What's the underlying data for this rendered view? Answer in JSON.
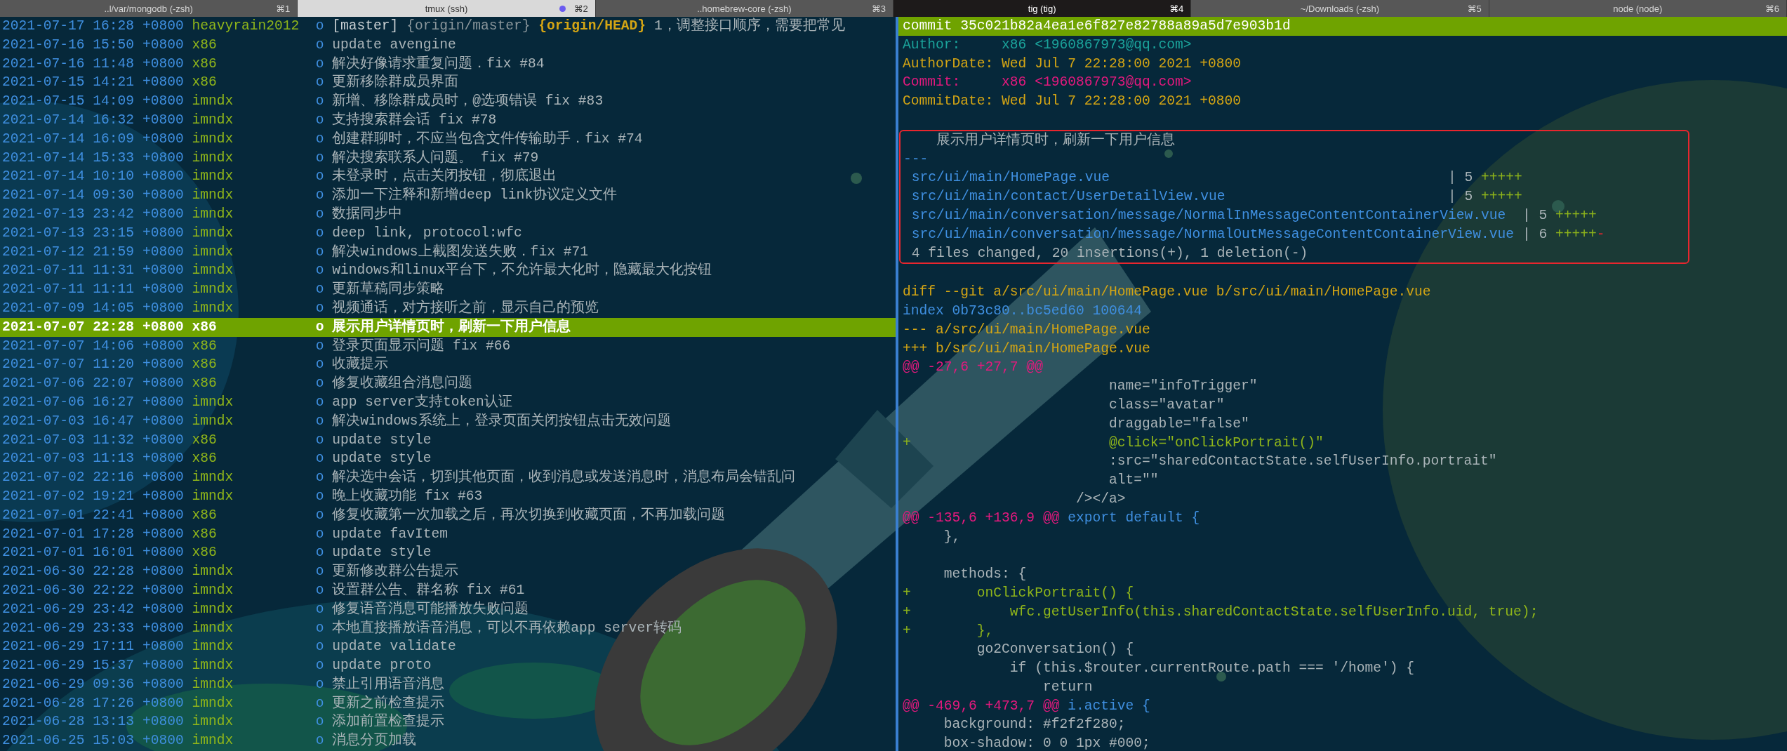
{
  "tabs": [
    {
      "label": "..l/var/mongodb (-zsh)",
      "shortcut": "⌘1",
      "selected": false,
      "activity": false
    },
    {
      "label": "tmux (ssh)",
      "shortcut": "⌘2",
      "selected": false,
      "activity": true
    },
    {
      "label": "..homebrew-core (-zsh)",
      "shortcut": "⌘3",
      "selected": false,
      "activity": false
    },
    {
      "label": "tig (tig)",
      "shortcut": "⌘4",
      "selected": true,
      "activity": false
    },
    {
      "label": "~/Downloads (-zsh)",
      "shortcut": "⌘5",
      "selected": false,
      "activity": false
    },
    {
      "label": "node (node)",
      "shortcut": "⌘6",
      "selected": false,
      "activity": false
    }
  ],
  "log_view": {
    "rows": [
      {
        "date": "2021-07-17 16:28 +0800",
        "author": "heavyrain2012",
        "graph": "o",
        "refs": [
          {
            "text": "[master]",
            "kind": "branch"
          },
          {
            "text": "{origin/master}",
            "kind": "remote"
          },
          {
            "text": "{origin/HEAD}",
            "kind": "head"
          }
        ],
        "message": "1，调整接口顺序，需要把常见",
        "selected": false
      },
      {
        "date": "2021-07-16 15:50 +0800",
        "author": "x86",
        "graph": "o",
        "message": "update avengine",
        "selected": false
      },
      {
        "date": "2021-07-16 11:48 +0800",
        "author": "x86",
        "graph": "o",
        "message": "解决好像请求重复问题．fix #84",
        "selected": false
      },
      {
        "date": "2021-07-15 14:21 +0800",
        "author": "x86",
        "graph": "o",
        "message": "更新移除群成员界面",
        "selected": false
      },
      {
        "date": "2021-07-15 14:09 +0800",
        "author": "imndx",
        "graph": "o",
        "message": "新增、移除群成员时，@选项错误 fix #83",
        "selected": false
      },
      {
        "date": "2021-07-14 16:32 +0800",
        "author": "imndx",
        "graph": "o",
        "message": "支持搜索群会话 fix #78",
        "selected": false
      },
      {
        "date": "2021-07-14 16:09 +0800",
        "author": "imndx",
        "graph": "o",
        "message": "创建群聊时，不应当包含文件传输助手．fix #74",
        "selected": false
      },
      {
        "date": "2021-07-14 15:33 +0800",
        "author": "imndx",
        "graph": "o",
        "message": "解决搜索联系人问题。 fix #79",
        "selected": false
      },
      {
        "date": "2021-07-14 10:10 +0800",
        "author": "imndx",
        "graph": "o",
        "message": "未登录时，点击关闭按钮，彻底退出",
        "selected": false
      },
      {
        "date": "2021-07-14 09:30 +0800",
        "author": "imndx",
        "graph": "o",
        "message": "添加一下注释和新增deep link协议定义文件",
        "selected": false
      },
      {
        "date": "2021-07-13 23:42 +0800",
        "author": "imndx",
        "graph": "o",
        "message": "数据同步中",
        "selected": false
      },
      {
        "date": "2021-07-13 23:15 +0800",
        "author": "imndx",
        "graph": "o",
        "message": "deep link, protocol:wfc",
        "selected": false
      },
      {
        "date": "2021-07-12 21:59 +0800",
        "author": "imndx",
        "graph": "o",
        "message": "解决windows上截图发送失败．fix #71",
        "selected": false
      },
      {
        "date": "2021-07-11 11:31 +0800",
        "author": "imndx",
        "graph": "o",
        "message": "windows和linux平台下，不允许最大化时，隐藏最大化按钮",
        "selected": false
      },
      {
        "date": "2021-07-11 11:11 +0800",
        "author": "imndx",
        "graph": "o",
        "message": "更新草稿同步策略",
        "selected": false
      },
      {
        "date": "2021-07-09 14:05 +0800",
        "author": "imndx",
        "graph": "o",
        "message": "视频通话，对方接听之前，显示自己的预览",
        "selected": false
      },
      {
        "date": "2021-07-07 22:28 +0800",
        "author": "x86",
        "graph": "o",
        "message": "展示用户详情页时，刷新一下用户信息",
        "selected": true
      },
      {
        "date": "2021-07-07 14:06 +0800",
        "author": "x86",
        "graph": "o",
        "message": "登录页面显示问题 fix #66",
        "selected": false
      },
      {
        "date": "2021-07-07 11:20 +0800",
        "author": "x86",
        "graph": "o",
        "message": "收藏提示",
        "selected": false
      },
      {
        "date": "2021-07-06 22:07 +0800",
        "author": "x86",
        "graph": "o",
        "message": "修复收藏组合消息问题",
        "selected": false
      },
      {
        "date": "2021-07-06 16:27 +0800",
        "author": "imndx",
        "graph": "o",
        "message": "app server支持token认证",
        "selected": false
      },
      {
        "date": "2021-07-03 16:47 +0800",
        "author": "imndx",
        "graph": "o",
        "message": "解决windows系统上，登录页面关闭按钮点击无效问题",
        "selected": false
      },
      {
        "date": "2021-07-03 11:32 +0800",
        "author": "x86",
        "graph": "o",
        "message": "update style",
        "selected": false
      },
      {
        "date": "2021-07-03 11:13 +0800",
        "author": "x86",
        "graph": "o",
        "message": "update style",
        "selected": false
      },
      {
        "date": "2021-07-02 22:16 +0800",
        "author": "imndx",
        "graph": "o",
        "message": "解决选中会话，切到其他页面，收到消息或发送消息时，消息布局会错乱问",
        "selected": false
      },
      {
        "date": "2021-07-02 19:21 +0800",
        "author": "imndx",
        "graph": "o",
        "message": "晚上收藏功能 fix #63",
        "selected": false
      },
      {
        "date": "2021-07-01 22:41 +0800",
        "author": "x86",
        "graph": "o",
        "message": "修复收藏第一次加载之后，再次切换到收藏页面，不再加载问题",
        "selected": false
      },
      {
        "date": "2021-07-01 17:28 +0800",
        "author": "x86",
        "graph": "o",
        "message": "update favItem",
        "selected": false
      },
      {
        "date": "2021-07-01 16:01 +0800",
        "author": "x86",
        "graph": "o",
        "message": "update style",
        "selected": false
      },
      {
        "date": "2021-06-30 22:28 +0800",
        "author": "imndx",
        "graph": "o",
        "message": "更新修改群公告提示",
        "selected": false
      },
      {
        "date": "2021-06-30 22:22 +0800",
        "author": "imndx",
        "graph": "o",
        "message": "设置群公告、群名称 fix #61",
        "selected": false
      },
      {
        "date": "2021-06-29 23:42 +0800",
        "author": "imndx",
        "graph": "o",
        "message": "修复语音消息可能播放失败问题",
        "selected": false
      },
      {
        "date": "2021-06-29 23:33 +0800",
        "author": "imndx",
        "graph": "o",
        "message": "本地直接播放语音消息，可以不再依赖app server转码",
        "selected": false
      },
      {
        "date": "2021-06-29 17:11 +0800",
        "author": "imndx",
        "graph": "o",
        "message": "update validate",
        "selected": false
      },
      {
        "date": "2021-06-29 15:37 +0800",
        "author": "imndx",
        "graph": "o",
        "message": "update proto",
        "selected": false
      },
      {
        "date": "2021-06-29 09:36 +0800",
        "author": "imndx",
        "graph": "o",
        "message": "禁止引用语音消息",
        "selected": false
      },
      {
        "date": "2021-06-28 17:26 +0800",
        "author": "imndx",
        "graph": "o",
        "message": "更新之前检查提示",
        "selected": false
      },
      {
        "date": "2021-06-28 13:13 +0800",
        "author": "imndx",
        "graph": "o",
        "message": "添加前置检查提示",
        "selected": false
      },
      {
        "date": "2021-06-25 15:03 +0800",
        "author": "imndx",
        "graph": "o",
        "message": "消息分页加载",
        "selected": false
      }
    ]
  },
  "diff_view": {
    "header_lines": [
      {
        "selected": true,
        "segments": [
          {
            "text": "commit 35c021b82a4ea1e6f827e82788a89a5d7e903b1d",
            "kind": "plain"
          }
        ]
      },
      {
        "selected": false,
        "segments": [
          {
            "text": "Author:     x86 <1960867973@qq.com>",
            "kind": "teal"
          }
        ]
      },
      {
        "selected": false,
        "segments": [
          {
            "text": "AuthorDate: Wed Jul 7 22:28:00 2021 +0800",
            "kind": "yellow"
          }
        ]
      },
      {
        "selected": false,
        "segments": [
          {
            "text": "Commit:     x86 <1960867973@qq.com>",
            "kind": "magenta"
          }
        ]
      },
      {
        "selected": false,
        "segments": [
          {
            "text": "CommitDate: Wed Jul 7 22:28:00 2021 +0800",
            "kind": "yellow"
          }
        ]
      }
    ],
    "highlighted_block": [
      {
        "segments": [
          {
            "text": "    展示用户详情页时，刷新一下用户信息",
            "kind": "plain"
          }
        ]
      },
      {
        "segments": [
          {
            "text": "---",
            "kind": "blue"
          }
        ]
      },
      {
        "segments": [
          {
            "text": " src/ui/main/HomePage.vue                                         ",
            "kind": "blue"
          },
          {
            "text": "| 5",
            "kind": "plain"
          },
          {
            "text": " +++++",
            "kind": "green"
          }
        ]
      },
      {
        "segments": [
          {
            "text": " src/ui/main/contact/UserDetailView.vue                           ",
            "kind": "blue"
          },
          {
            "text": "| 5",
            "kind": "plain"
          },
          {
            "text": " +++++",
            "kind": "green"
          }
        ]
      },
      {
        "segments": [
          {
            "text": " src/ui/main/conversation/message/NormalInMessageContentContainerView.vue  ",
            "kind": "blue"
          },
          {
            "text": "| 5",
            "kind": "plain"
          },
          {
            "text": " +++++",
            "kind": "green"
          }
        ]
      },
      {
        "segments": [
          {
            "text": " src/ui/main/conversation/message/NormalOutMessageContentContainerView.vue ",
            "kind": "blue"
          },
          {
            "text": "| 6",
            "kind": "plain"
          },
          {
            "text": " +++++",
            "kind": "green"
          },
          {
            "text": "-",
            "kind": "red"
          }
        ]
      },
      {
        "segments": [
          {
            "text": " 4 files changed, 20 insertions(+), 1 deletion(-)",
            "kind": "plain"
          }
        ]
      }
    ],
    "diff_lines": [
      {
        "segments": [
          {
            "text": "diff --git a/src/ui/main/HomePage.vue b/src/ui/main/HomePage.vue",
            "kind": "yellow"
          }
        ]
      },
      {
        "segments": [
          {
            "text": "index 0b73c80..bc5ed60 100644",
            "kind": "blue"
          }
        ]
      },
      {
        "segments": [
          {
            "text": "--- a/src/ui/main/HomePage.vue",
            "kind": "yellow"
          }
        ]
      },
      {
        "segments": [
          {
            "text": "+++ b/src/ui/main/HomePage.vue",
            "kind": "yellow"
          }
        ]
      },
      {
        "segments": [
          {
            "text": "@@ -27,6 +27,7 @@",
            "kind": "magenta"
          }
        ]
      },
      {
        "segments": [
          {
            "text": "                         name=\"infoTrigger\"",
            "kind": "plain"
          }
        ]
      },
      {
        "segments": [
          {
            "text": "                         class=\"avatar\"",
            "kind": "plain"
          }
        ]
      },
      {
        "segments": [
          {
            "text": "                         draggable=\"false\"",
            "kind": "plain"
          }
        ]
      },
      {
        "segments": [
          {
            "text": "+",
            "kind": "green"
          },
          {
            "text": "                        @click=\"onClickPortrait()\"",
            "kind": "green"
          }
        ]
      },
      {
        "segments": [
          {
            "text": "                         :src=\"sharedContactState.selfUserInfo.portrait\"",
            "kind": "plain"
          }
        ]
      },
      {
        "segments": [
          {
            "text": "                         alt=\"\"",
            "kind": "plain"
          }
        ]
      },
      {
        "segments": [
          {
            "text": "                     /></a>",
            "kind": "plain"
          }
        ]
      },
      {
        "segments": [
          {
            "text": "@@ -135,6 +136,9 @@",
            "kind": "magenta"
          },
          {
            "text": " export default {",
            "kind": "blue"
          }
        ]
      },
      {
        "segments": [
          {
            "text": "     },",
            "kind": "plain"
          }
        ]
      },
      {
        "gap_before": true,
        "segments": [
          {
            "text": "     methods: {",
            "kind": "plain"
          }
        ]
      },
      {
        "segments": [
          {
            "text": "+",
            "kind": "green"
          },
          {
            "text": "        onClickPortrait() {",
            "kind": "green"
          }
        ]
      },
      {
        "segments": [
          {
            "text": "+",
            "kind": "green"
          },
          {
            "text": "            wfc.getUserInfo(this.sharedContactState.selfUserInfo.uid, true);",
            "kind": "green"
          }
        ]
      },
      {
        "segments": [
          {
            "text": "+",
            "kind": "green"
          },
          {
            "text": "        },",
            "kind": "green"
          }
        ]
      },
      {
        "segments": [
          {
            "text": "         go2Conversation() {",
            "kind": "plain"
          }
        ]
      },
      {
        "segments": [
          {
            "text": "             if (this.$router.currentRoute.path === '/home') {",
            "kind": "plain"
          }
        ]
      },
      {
        "segments": [
          {
            "text": "                 return",
            "kind": "plain"
          }
        ]
      },
      {
        "segments": [
          {
            "text": "@@ -469,6 +473,7 @@",
            "kind": "magenta"
          },
          {
            "text": " i.active {",
            "kind": "blue"
          }
        ]
      },
      {
        "segments": [
          {
            "text": "     background: #f2f2f280;",
            "kind": "plain"
          }
        ]
      },
      {
        "segments": [
          {
            "text": "     box-shadow: 0 0 1px #000;",
            "kind": "plain"
          }
        ]
      }
    ]
  }
}
